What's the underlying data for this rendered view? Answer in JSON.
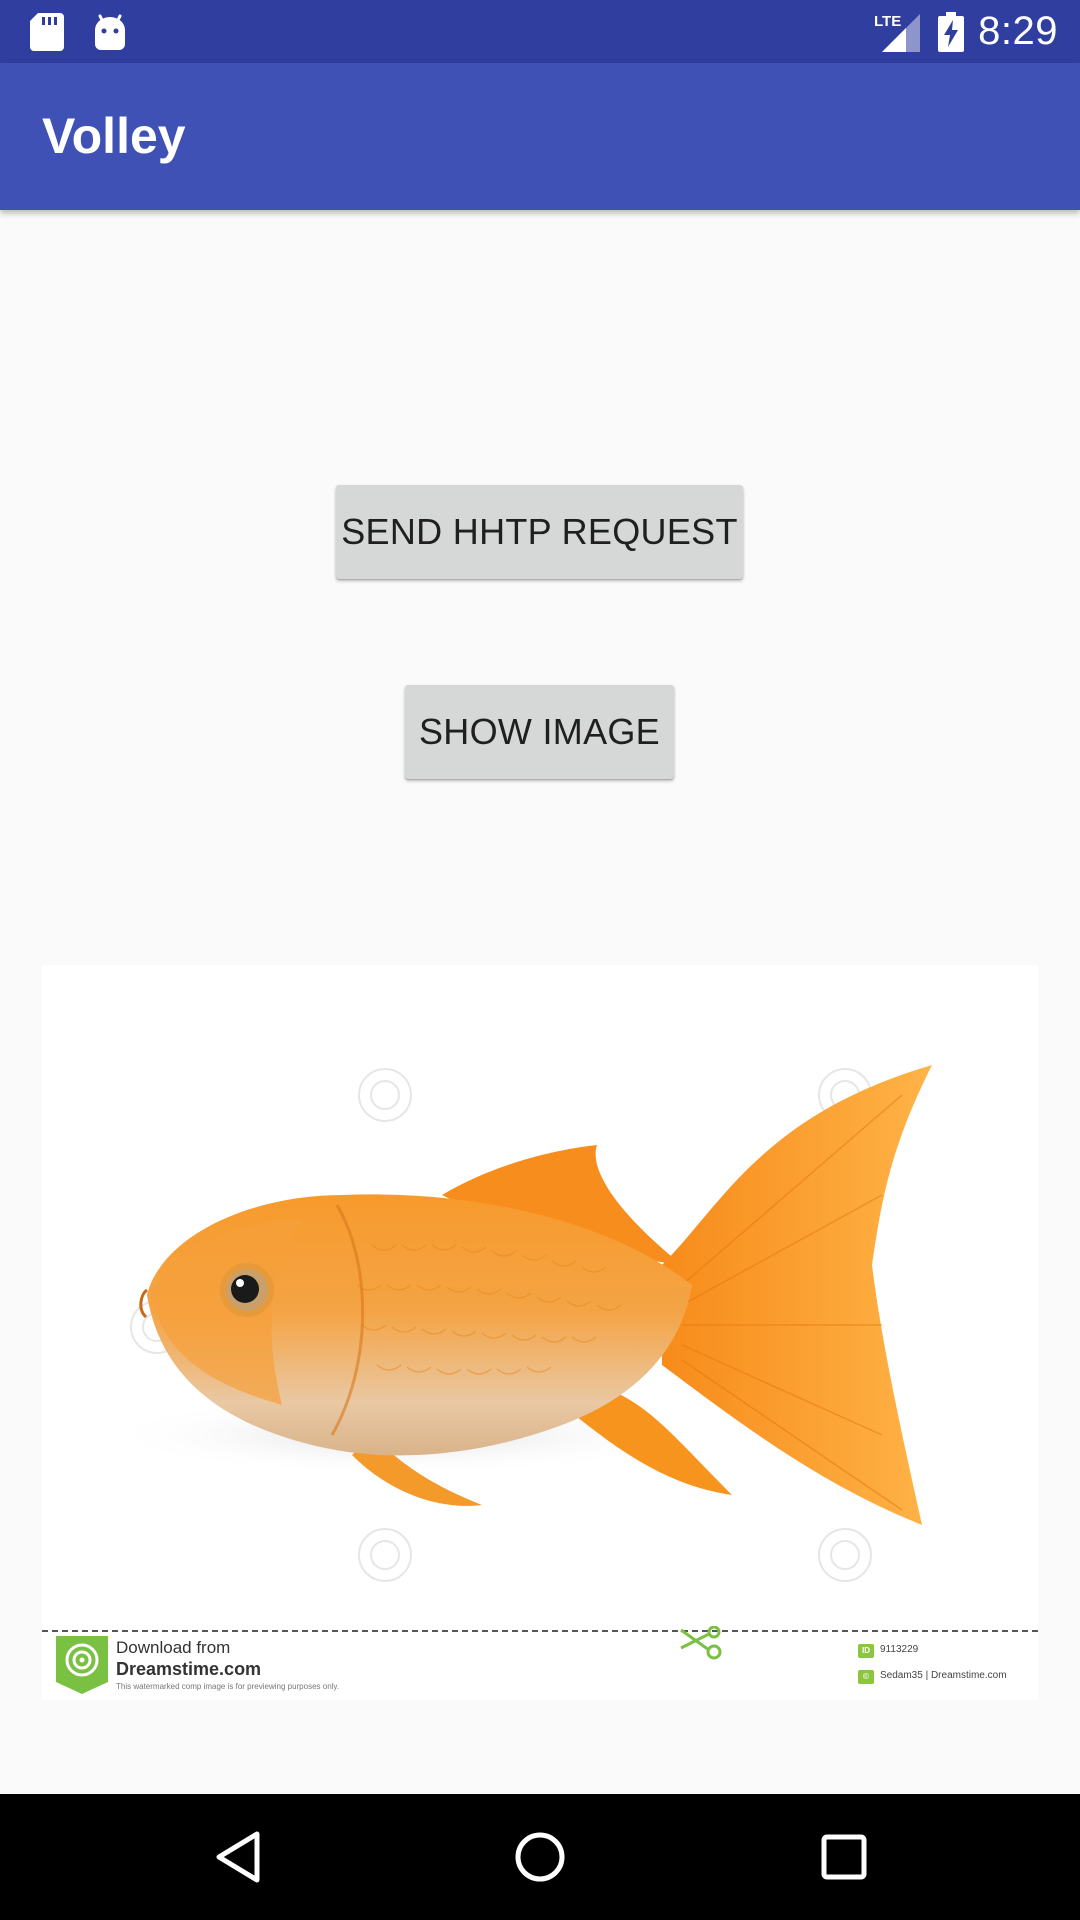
{
  "status_bar": {
    "time": "8:29",
    "network": "LTE",
    "icons": [
      "sd-card-icon",
      "android-icon",
      "lte-signal-icon",
      "battery-charging-icon"
    ]
  },
  "app_bar": {
    "title": "Volley"
  },
  "main": {
    "send_button_label": "SEND HHTP REQUEST",
    "show_image_button_label": "SHOW IMAGE"
  },
  "image": {
    "subject": "goldfish-photo",
    "watermark": {
      "download_text": "Download from",
      "brand": "Dreamstime.com",
      "note": "This watermarked comp image is for previewing purposes only.",
      "id": "9113229",
      "credit": "Sedam35 | Dreamstime.com"
    }
  },
  "nav_bar": {
    "icons": [
      "back-icon",
      "home-icon",
      "recents-icon"
    ]
  },
  "colors": {
    "status_bar": "#303f9f",
    "app_bar": "#3f51b5",
    "background": "#fafafa",
    "button": "#d6d7d7",
    "fish_orange": "#f7931e"
  }
}
